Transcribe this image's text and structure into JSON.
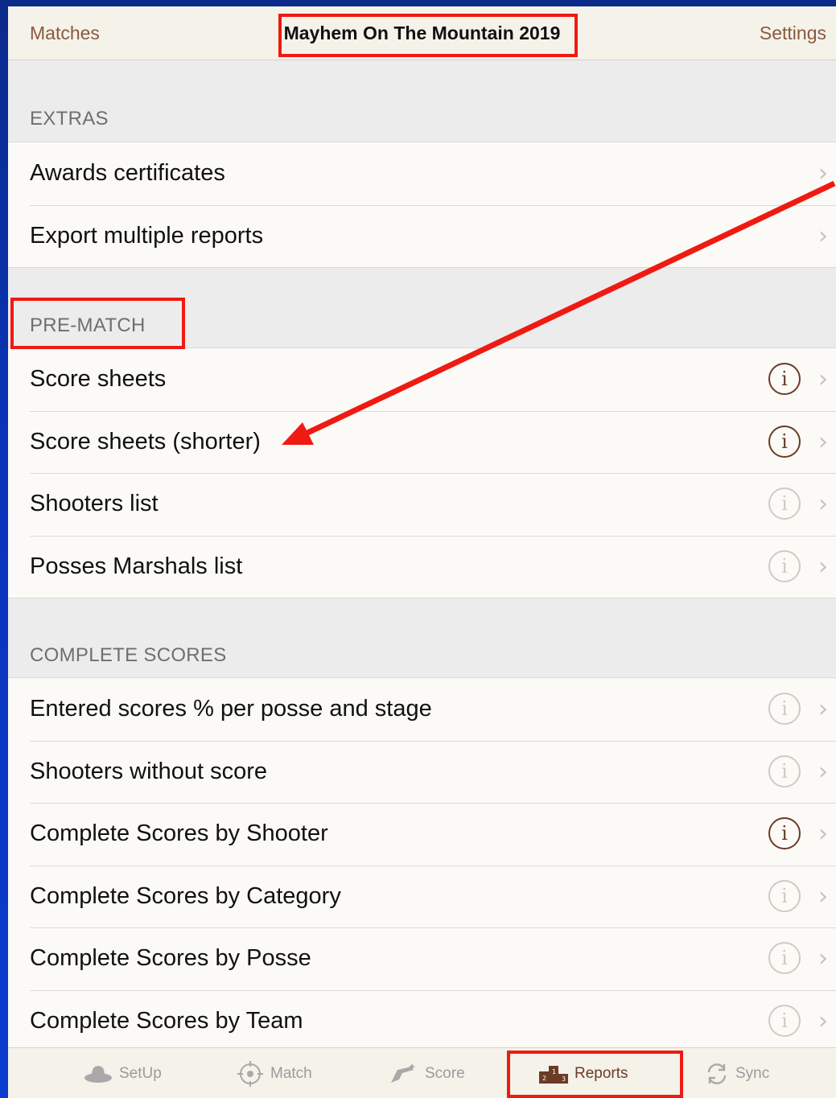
{
  "navbar": {
    "left_label": "Matches",
    "title": "Mayhem On The Mountain 2019",
    "right_label": "Settings"
  },
  "sections": {
    "extras": {
      "header": "EXTRAS",
      "rows": [
        {
          "label": "Awards certificates"
        },
        {
          "label": "Export multiple reports"
        }
      ]
    },
    "prematch": {
      "header": "PRE-MATCH",
      "rows": [
        {
          "label": "Score sheets",
          "info": "active"
        },
        {
          "label": "Score sheets (shorter)",
          "info": "active"
        },
        {
          "label": "Shooters list",
          "info": "inactive"
        },
        {
          "label": "Posses Marshals list",
          "info": "inactive"
        }
      ]
    },
    "complete": {
      "header": "COMPLETE SCORES",
      "rows": [
        {
          "label": "Entered scores % per posse and stage",
          "info": "inactive"
        },
        {
          "label": "Shooters without score",
          "info": "inactive"
        },
        {
          "label": "Complete Scores by Shooter",
          "info": "active"
        },
        {
          "label": "Complete Scores by Category",
          "info": "inactive"
        },
        {
          "label": "Complete Scores by Posse",
          "info": "inactive"
        },
        {
          "label": "Complete Scores by Team",
          "info": "inactive"
        }
      ]
    }
  },
  "tabbar": {
    "tabs": [
      {
        "label": "SetUp",
        "icon": "cowboy-hat-icon"
      },
      {
        "label": "Match",
        "icon": "target-icon"
      },
      {
        "label": "Score",
        "icon": "revolver-icon"
      },
      {
        "label": "Reports",
        "icon": "podium-icon",
        "selected": true
      },
      {
        "label": "Sync",
        "icon": "sync-icon"
      }
    ]
  },
  "icons": {
    "info": "ⓘ",
    "chevron": "›"
  },
  "colors": {
    "accent": "#8a5a3c",
    "selected_tab": "#6b3b26",
    "annotation_red": "#ef1a12",
    "background_blue": "#0a33b8"
  }
}
